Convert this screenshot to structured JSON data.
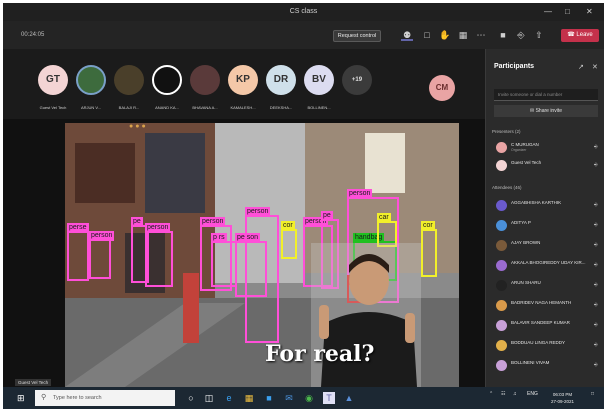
{
  "window": {
    "title": "CS class",
    "controls": [
      "—",
      "□",
      "✕"
    ]
  },
  "meeting": {
    "timer": "00:24:05",
    "request_control_label": "Request control",
    "leave_label": "Leave",
    "toolbar_icons": [
      "people-icon",
      "chat-icon",
      "raise-hand-icon",
      "breakout-icon",
      "more-icon",
      "camera-icon",
      "mic-icon",
      "share-icon"
    ]
  },
  "strip": {
    "tiles": [
      {
        "initials": "GT",
        "name": "Guest Vel Tech",
        "color": "#f3d4d4",
        "image": false
      },
      {
        "initials": "",
        "name": "ARJUN V...",
        "color": "#3d6b3d",
        "image": true
      },
      {
        "initials": "",
        "name": "BALAJI R...",
        "color": "#4a3f2a",
        "image": true
      },
      {
        "initials": "",
        "name": "ANAND KA...",
        "color": "#111111",
        "image": true
      },
      {
        "initials": "",
        "name": "BHAVANA A...",
        "color": "#5a3a3a",
        "image": true
      },
      {
        "initials": "KP",
        "name": "KAMALESH...",
        "color": "#f4c8a8",
        "image": false
      },
      {
        "initials": "DR",
        "name": "DEEKSHA...",
        "color": "#cfe0ea",
        "image": false
      },
      {
        "initials": "BV",
        "name": "BOLLINEN...",
        "color": "#dcdcf0",
        "image": false
      },
      {
        "initials": "+19",
        "name": "",
        "color": "#3b3b3b",
        "image": false
      }
    ],
    "self_initials": "CM"
  },
  "stage": {
    "caption": "For real?",
    "self_label": "Guest Vel Tech",
    "detections": [
      {
        "label": "perse",
        "cls": "p"
      },
      {
        "label": "person",
        "cls": "p"
      },
      {
        "label": "pe",
        "cls": "p"
      },
      {
        "label": "person",
        "cls": "p"
      },
      {
        "label": "person",
        "cls": "p"
      },
      {
        "label": "p rs",
        "cls": "p"
      },
      {
        "label": "pe son",
        "cls": "p"
      },
      {
        "label": "person",
        "cls": "p"
      },
      {
        "label": "person",
        "cls": "p"
      },
      {
        "label": "cor",
        "cls": "y"
      },
      {
        "label": "pe",
        "cls": "p"
      },
      {
        "label": "person",
        "cls": "p"
      },
      {
        "label": "handbag",
        "cls": "g"
      },
      {
        "label": "car",
        "cls": "y"
      },
      {
        "label": "cor",
        "cls": "y"
      },
      {
        "label": "bo",
        "cls": "r"
      }
    ]
  },
  "panel": {
    "title": "Participants",
    "search_placeholder": "Invite someone or dial a number",
    "share_invite_label": "Share invite",
    "presenters_heading": "Presenters (2)",
    "attendees_heading": "Attendees (46)",
    "presenters": [
      {
        "name": "C MURUGAN",
        "role": "Organizer",
        "color": "#e9a4a4"
      },
      {
        "name": "Guest Vel Tech",
        "role": "",
        "color": "#f3d4d4"
      }
    ],
    "attendees": [
      {
        "name": "AGGABHISHA KARTHIK",
        "color": "#6a5acd"
      },
      {
        "name": "ADITYA P",
        "color": "#4a90d9"
      },
      {
        "name": "AJAY BROWN",
        "color": "#7a5a3a"
      },
      {
        "name": "AKKALA BHOGIREDDY UDAY KIR...",
        "color": "#9a6bd0"
      },
      {
        "name": "ARUN SHARU",
        "color": "#222222"
      },
      {
        "name": "BADRIDEV NAGA HEMANTH",
        "color": "#d99a4a"
      },
      {
        "name": "BALAVIR SANDEEP KUMAR",
        "color": "#c8a0d8"
      },
      {
        "name": "BODDUAU LINGA REDDY",
        "color": "#e2b04a"
      },
      {
        "name": "BOLLINENI VIVAM",
        "color": "#c8a0d8"
      }
    ]
  },
  "taskbar": {
    "search_placeholder": "Type here to search",
    "apps": [
      "task-view-icon",
      "edge-icon",
      "file-explorer-icon",
      "store-icon",
      "mail-icon",
      "chrome-icon",
      "teams-icon",
      "photos-icon"
    ],
    "tray": "ENG",
    "time": "06:03 PM",
    "date": "27-09-2021"
  }
}
